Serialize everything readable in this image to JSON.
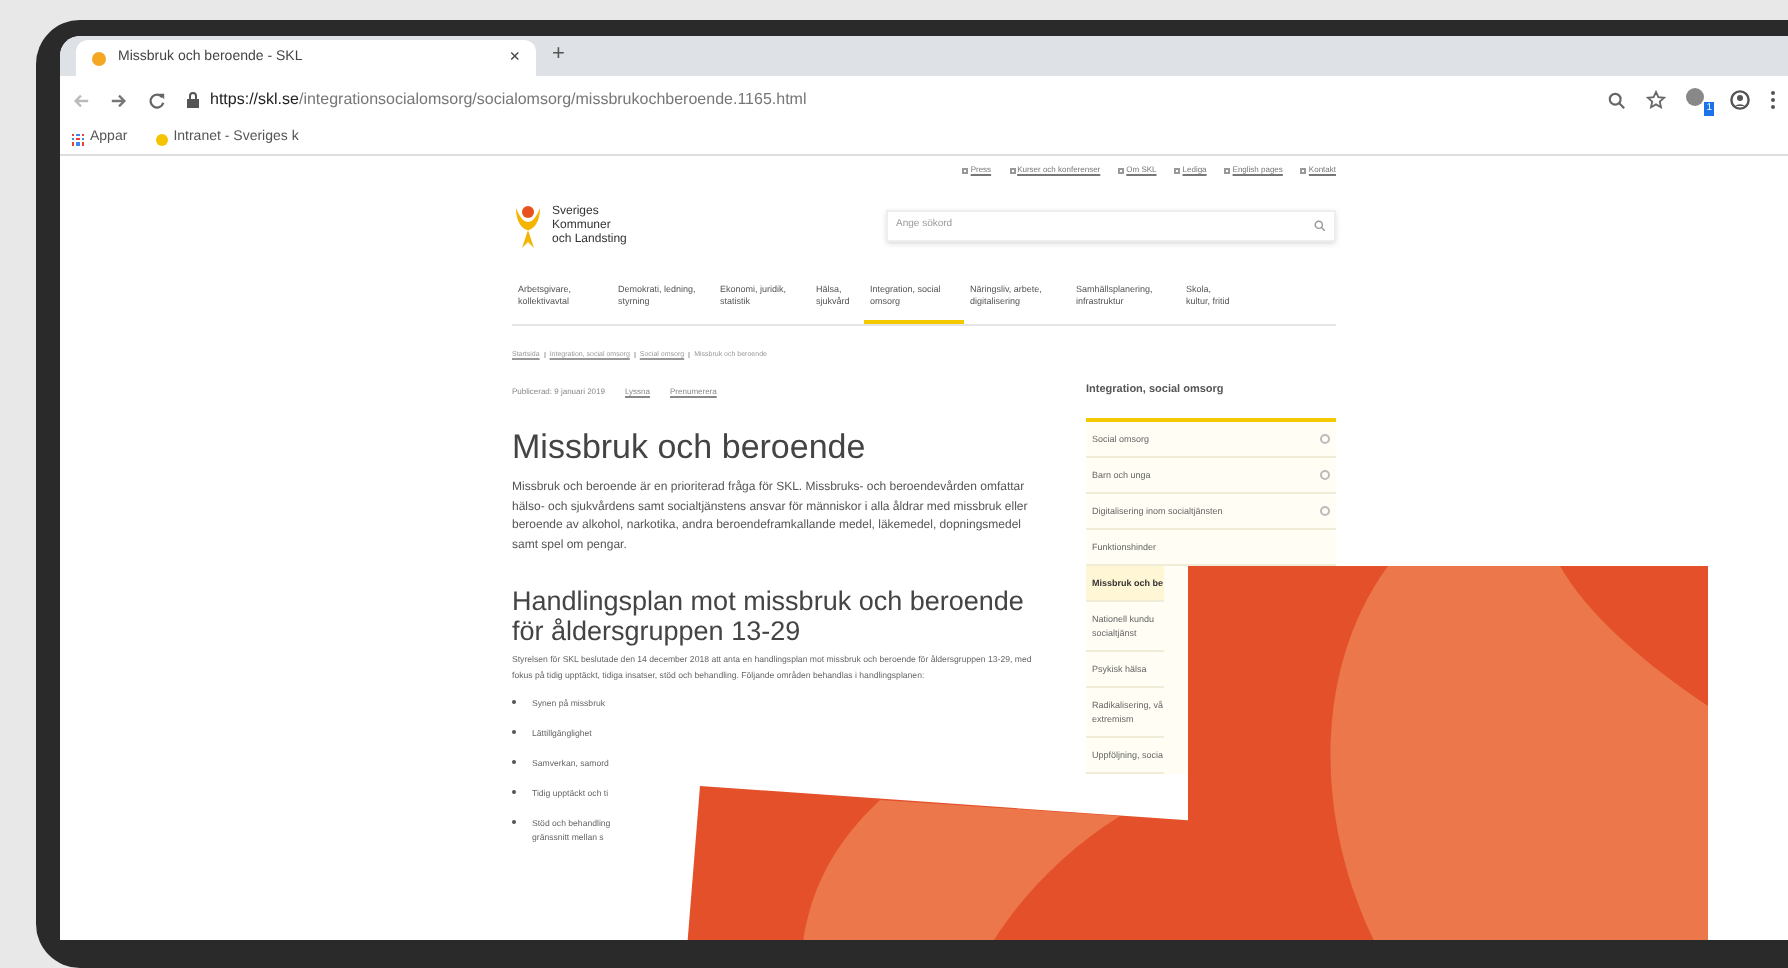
{
  "browser": {
    "tab_title": "Missbruk och beroende - SKL",
    "tab_close": "×",
    "new_tab": "+",
    "url_host": "https://skl.se",
    "url_path": "/integrationsocialomsorg/socialomsorg/missbrukochberoende.1165.html",
    "extension_badge": "1",
    "bookmarks": [
      "Appar",
      "Intranet - Sveriges k"
    ]
  },
  "top_links": [
    "Press",
    "Kurser och konferenser",
    "Om SKL",
    "Lediga",
    "English pages",
    "Kontakt"
  ],
  "logo": {
    "lines": [
      "Sveriges",
      "Kommuner",
      "och Landsting"
    ]
  },
  "search": {
    "placeholder": "Ange sökord"
  },
  "nav": [
    {
      "label": "Arbetsgivare, kollektivavtal",
      "selected": false
    },
    {
      "label": "Demokrati, ledning, styrning",
      "selected": false
    },
    {
      "label": "Ekonomi, juridik, statistik",
      "selected": false
    },
    {
      "label": "Hälsa, sjukvård",
      "selected": false
    },
    {
      "label": "Integration, social omsorg",
      "selected": true
    },
    {
      "label": "Näringsliv, arbete, digitalisering",
      "selected": false
    },
    {
      "label": "Samhällsplanering, infrastruktur",
      "selected": false
    },
    {
      "label": "Skola, kultur, fritid",
      "selected": false
    }
  ],
  "breadcrumb": [
    "Startsida",
    "Integration, social omsorg",
    "Social omsorg",
    "Missbruk och beroende"
  ],
  "meta": {
    "published": "Publicerad: 9 januari 2019",
    "listen": "Lyssna",
    "subscribe": "Prenumerera"
  },
  "title": "Missbruk och beroende",
  "intro": "Missbruk och beroende är en prioriterad fråga för SKL. Missbruks- och beroendevården omfattar hälso- och sjukvårdens samt socialtjänstens ansvar för människor i alla åldrar med missbruk eller beroende av alkohol, narkotika, andra beroendeframkallande medel, läkemedel, dopningsmedel samt spel om pengar.",
  "section_heading": "Handlingsplan mot missbruk och beroende för åldersgruppen 13-29",
  "section_text": "Styrelsen för SKL beslutade den 14 december 2018 att anta en handlingsplan mot missbruk och beroende för åldersgruppen 13-29, med fokus på tidig upptäckt, tidiga insatser, stöd och behandling. Följande områden behandlas i handlingsplanen:",
  "bullets": [
    "Synen på missbruk",
    "Lättillgänglighet",
    "Samverkan, samord",
    "Tidig upptäckt och ti",
    "Stöd och behandling\ngränssnitt mellan s"
  ],
  "sidebar": {
    "heading": "Integration, social omsorg",
    "items": [
      {
        "label": "Social omsorg",
        "selected": false,
        "expandable": true
      },
      {
        "label": "Barn och unga",
        "selected": false,
        "expandable": true
      },
      {
        "label": "Digitalisering inom socialtjänsten",
        "selected": false,
        "expandable": true
      },
      {
        "label": "Funktionshinder",
        "selected": false,
        "expandable": false
      },
      {
        "label": "Missbruk och be",
        "selected": true,
        "expandable": false
      },
      {
        "label": "Nationell kundu\nsocialtjänst",
        "selected": false,
        "expandable": false
      },
      {
        "label": "Psykisk hälsa",
        "selected": false,
        "expandable": false
      },
      {
        "label": "Radikalisering, vå\nextremism",
        "selected": false,
        "expandable": false
      },
      {
        "label": "Uppföljning, socia",
        "selected": false,
        "expandable": false
      }
    ]
  }
}
